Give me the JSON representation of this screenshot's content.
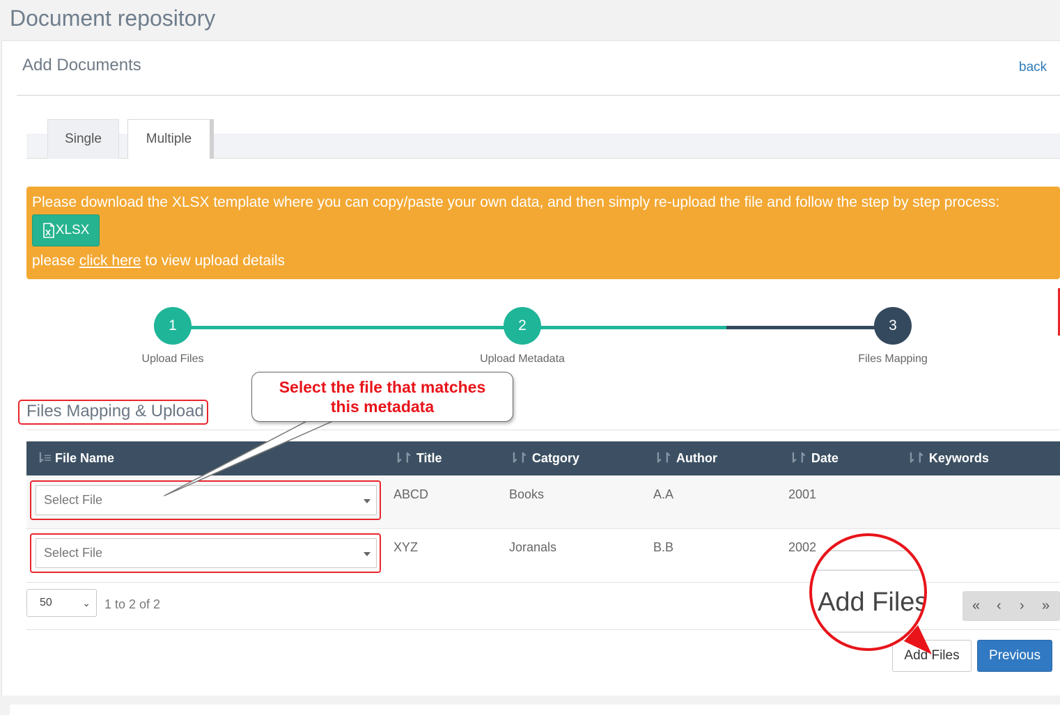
{
  "page": {
    "title": "Document repository"
  },
  "panel": {
    "title": "Add Documents",
    "back_label": "back"
  },
  "tabs": [
    {
      "label": "Single"
    },
    {
      "label": "Multiple"
    }
  ],
  "alert": {
    "text": "Please download the XLSX template where you can copy/paste your own data, and then simply re-upload the file and follow the step by step process:",
    "xlsx_label": "XLSX",
    "detail_prefix": "please ",
    "detail_link": "click here",
    "detail_suffix": " to view upload details",
    "color": "#f3a833"
  },
  "stepper": {
    "steps": [
      {
        "number": "1",
        "label": "Upload Files",
        "state": "done"
      },
      {
        "number": "2",
        "label": "Upload Metadata",
        "state": "done"
      },
      {
        "number": "3",
        "label": "Files Mapping",
        "state": "active"
      }
    ],
    "done_color": "#1fb598",
    "todo_color": "#34495e"
  },
  "section": {
    "title": "Files Mapping & Upload"
  },
  "callout": {
    "line1": "Select the file that matches",
    "line2": "this metadata"
  },
  "table": {
    "columns": [
      "File Name",
      "Title",
      "Catgory",
      "Author",
      "Date",
      "Keywords"
    ],
    "rows": [
      {
        "file": "Select File",
        "title": "ABCD",
        "category": "Books",
        "author": "A.A",
        "date": "2001",
        "keywords": ""
      },
      {
        "file": "Select File",
        "title": "XYZ",
        "category": "Joranals",
        "author": "B.B",
        "date": "2002",
        "keywords": ""
      }
    ]
  },
  "pagination": {
    "page_size": "50",
    "info": "1 to 2 of 2",
    "first": "«",
    "prev": "‹",
    "next": "›",
    "last": "»"
  },
  "actions": {
    "add_files_label": "Add Files",
    "previous_label": "Previous",
    "primary_color": "#3179c2"
  },
  "magnifier": {
    "text": "Add Files"
  }
}
